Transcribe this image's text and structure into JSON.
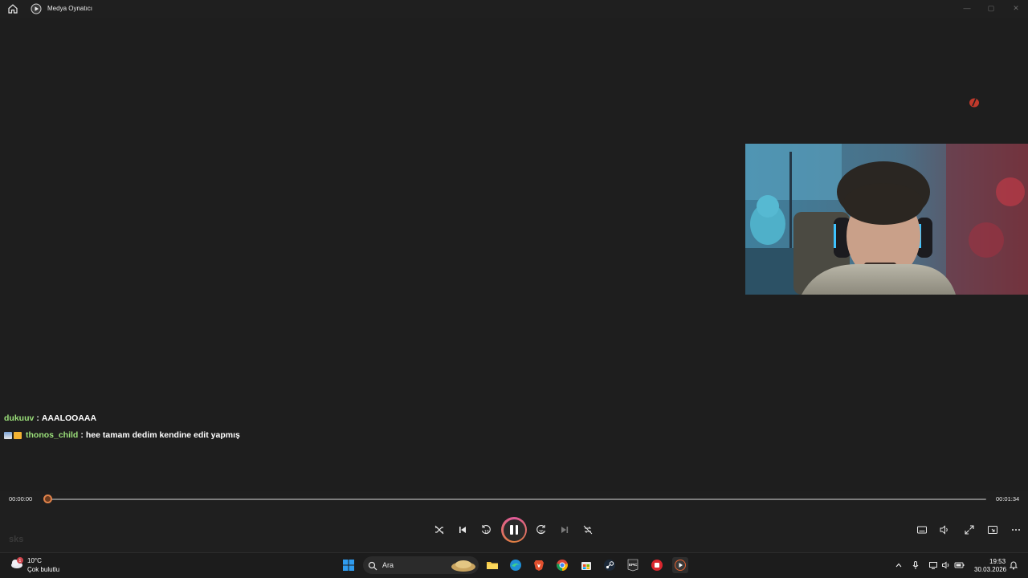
{
  "window": {
    "title": "Medya Oynatıcı",
    "minimize_glyph": "—",
    "maximize_glyph": "▢",
    "close_glyph": "✕"
  },
  "chat": [
    {
      "user": "dukuuv",
      "separator": ":",
      "message": "AAALOOAAA",
      "badges": []
    },
    {
      "user": "thonos_child",
      "separator": ":",
      "message": "hee tamam dedim kendine edit yapmış",
      "badges": [
        "badge-icon",
        "crown-badge-icon"
      ]
    }
  ],
  "player": {
    "elapsed": "00:00:00",
    "duration": "00:01:34",
    "progress": 0,
    "state": "playing",
    "watermark": "sks"
  },
  "taskbar": {
    "weather_temp": "10°C",
    "weather_desc": "Çok bulutlu",
    "weather_alert": "1",
    "search_placeholder": "Ara",
    "clock_time": "19:53",
    "clock_date": "30.03.2026",
    "epic_label": "EPIC"
  },
  "colors": {
    "username": "#9be07a",
    "accent": "#e0824a",
    "background": "#1f1f1f"
  }
}
